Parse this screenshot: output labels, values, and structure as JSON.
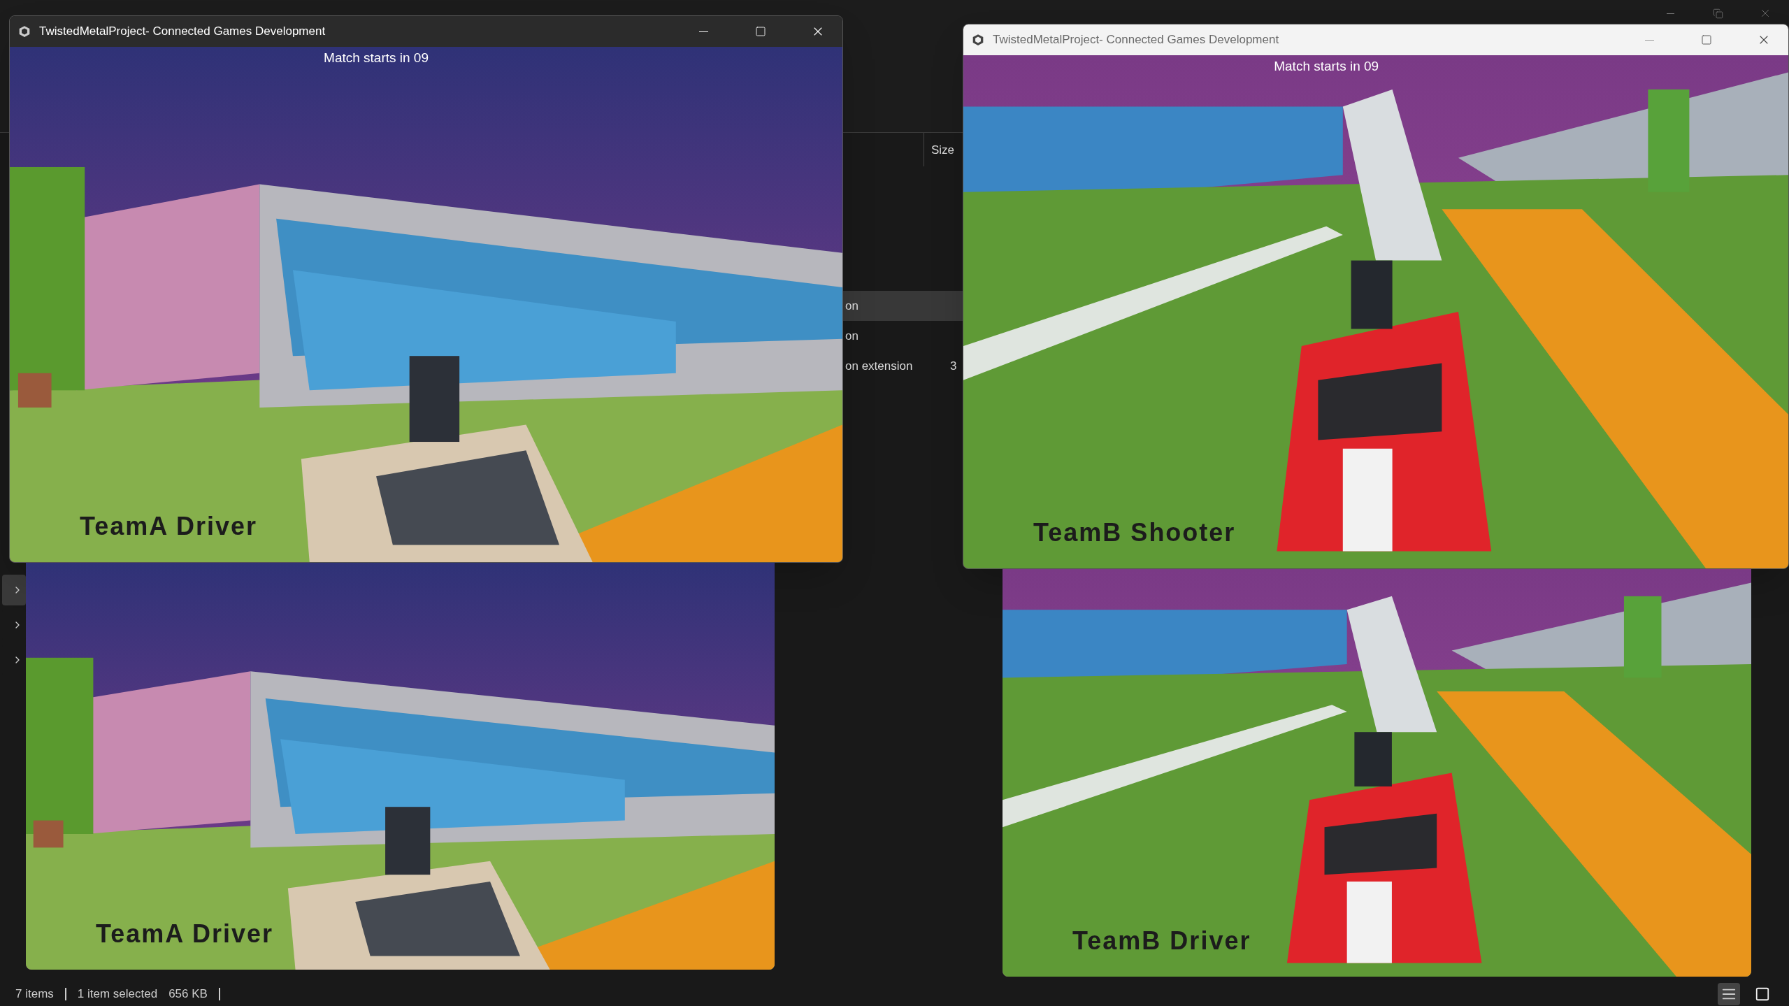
{
  "explorer": {
    "nav_items": [
      {
        "selected": true
      },
      {
        "selected": false
      },
      {
        "selected": false
      }
    ],
    "column_header": "Size",
    "rows": [
      {
        "name": "on",
        "selected": true
      },
      {
        "name": "on",
        "selected": false
      },
      {
        "name": "on extension",
        "size": "3",
        "selected": false
      }
    ],
    "status_bar": {
      "count": "7 items",
      "selection": "1 item selected",
      "size": "656 KB"
    },
    "view_buttons": [
      {
        "kind": "details",
        "selected": true
      },
      {
        "kind": "tiles",
        "selected": false
      }
    ]
  },
  "game_windows": [
    {
      "kind": "dark",
      "title": "TwistedMetalProject- Connected Games Development",
      "hud": "Match starts in 09",
      "player_label": "TeamA Driver"
    },
    {
      "kind": "light",
      "title": "TwistedMetalProject- Connected Games Development",
      "hud": "Match starts in 09",
      "player_label": "TeamB Shooter"
    },
    {
      "kind": "bare",
      "player_label": "TeamA Driver"
    },
    {
      "kind": "bare",
      "player_label": "TeamB Driver"
    }
  ]
}
